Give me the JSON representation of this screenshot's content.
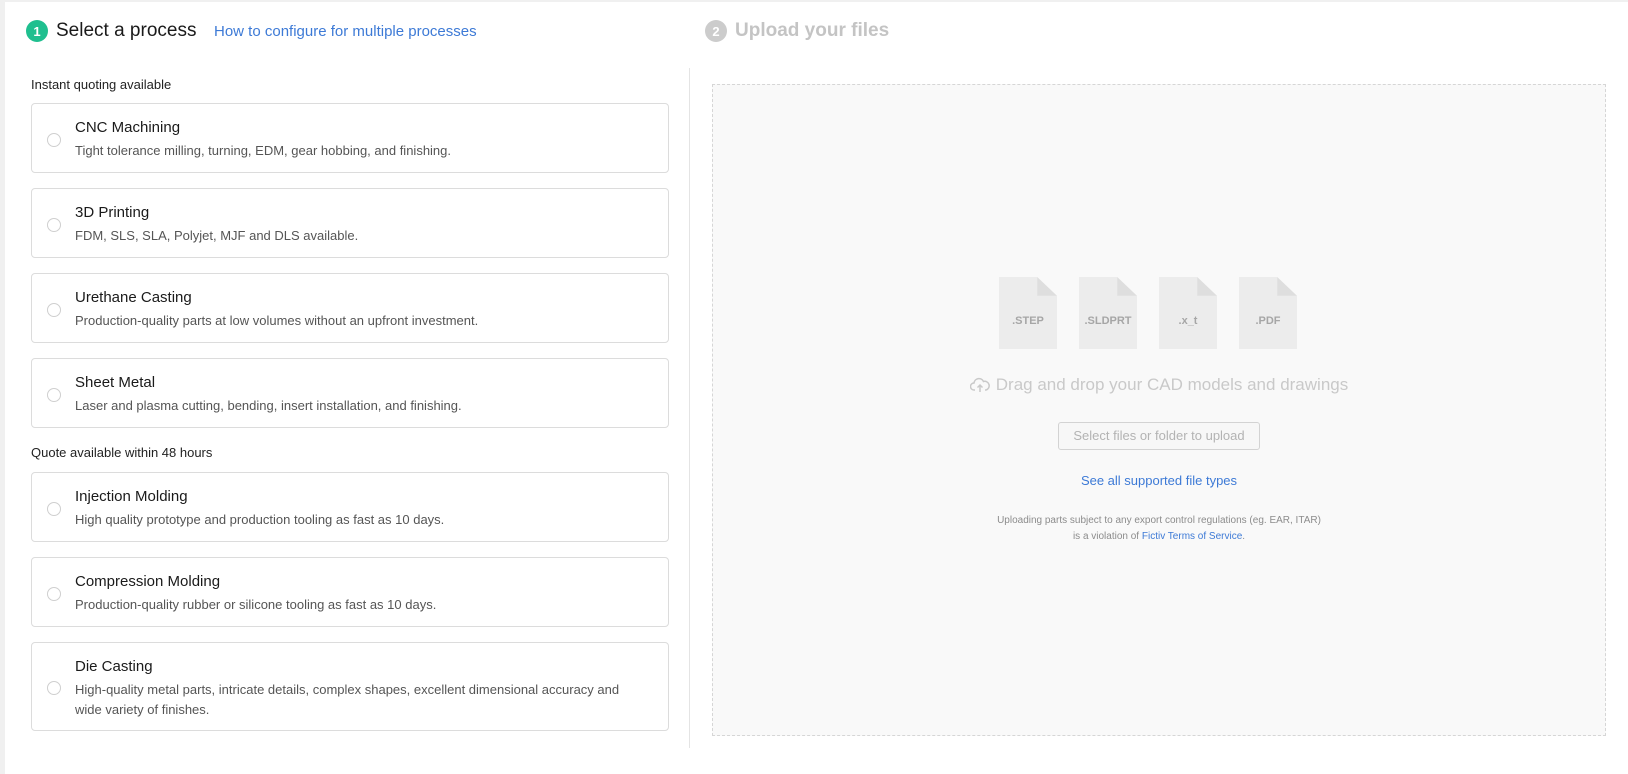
{
  "step1": {
    "number": "1",
    "title": "Select a process",
    "help_link": "How to configure for multiple processes"
  },
  "step2": {
    "number": "2",
    "title": "Upload your files"
  },
  "groups": [
    {
      "label": "Instant quoting available",
      "processes": [
        {
          "title": "CNC Machining",
          "description": "Tight tolerance milling, turning, EDM, gear hobbing, and finishing."
        },
        {
          "title": "3D Printing",
          "description": "FDM, SLS, SLA, Polyjet, MJF and DLS available."
        },
        {
          "title": "Urethane Casting",
          "description": "Production-quality parts at low volumes without an upfront investment."
        },
        {
          "title": "Sheet Metal",
          "description": "Laser and plasma cutting, bending, insert installation, and finishing."
        }
      ]
    },
    {
      "label": "Quote available within 48 hours",
      "processes": [
        {
          "title": "Injection Molding",
          "description": "High quality prototype and production tooling as fast as 10 days."
        },
        {
          "title": "Compression Molding",
          "description": "Production-quality rubber or silicone tooling as fast as 10 days."
        },
        {
          "title": "Die Casting",
          "description": "High-quality metal parts, intricate details, complex shapes, excellent dimensional accuracy and wide variety of finishes."
        }
      ]
    }
  ],
  "upload": {
    "file_types": [
      ".STEP",
      ".SLDPRT",
      ".x_t",
      ".PDF"
    ],
    "drop_text": "Drag and drop your CAD models and drawings",
    "select_button": "Select files or folder to upload",
    "supported_link": "See all supported file types",
    "notice_line1": "Uploading parts subject to any export control regulations (eg. EAR, ITAR)",
    "notice_line2_prefix": "is a violation of",
    "notice_link": "Fictiv Terms of Service",
    "notice_suffix": ".",
    "cloud_icon": "cloud-upload-icon"
  },
  "colors": {
    "accent": "#1fbf8f",
    "link": "#3d7ad6",
    "inactive": "#cccccc"
  }
}
